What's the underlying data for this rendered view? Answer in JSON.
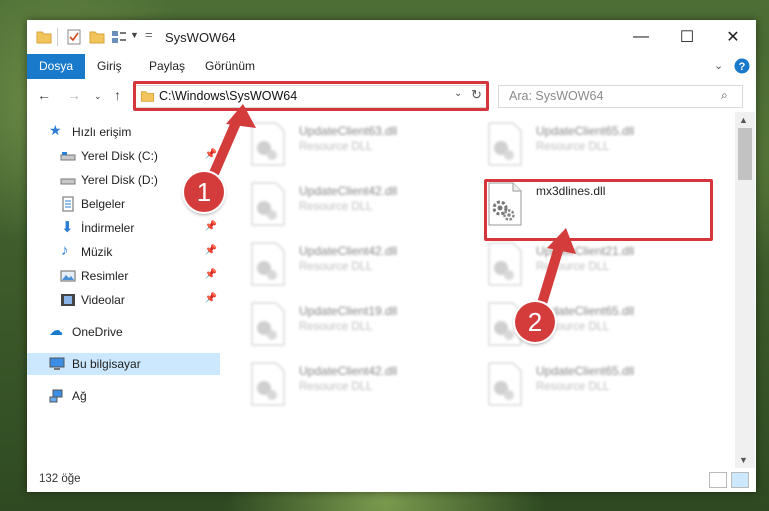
{
  "window": {
    "title": "SysWOW64",
    "quick_access_icons": [
      "folder-icon",
      "properties-icon",
      "new-folder-icon",
      "view-options-icon",
      "dropdown-arrow-icon"
    ],
    "controls": {
      "minimize": "—",
      "maximize": "☐",
      "close": "✕"
    }
  },
  "ribbon": {
    "tabs": [
      {
        "label": "Dosya"
      },
      {
        "label": "Giriş"
      },
      {
        "label": "Paylaş"
      },
      {
        "label": "Görünüm"
      }
    ],
    "expand_icon": "chevron-down-icon",
    "help_icon": "help-icon"
  },
  "address": {
    "path": "C:\\Windows\\SysWOW64",
    "search_placeholder": "Ara: SysWOW64"
  },
  "sidebar": {
    "items": [
      {
        "label": "Hızlı erişim",
        "icon": "star-icon",
        "pinned": false
      },
      {
        "label": "Yerel Disk (C:)",
        "icon": "drive-icon",
        "pinned": true
      },
      {
        "label": "Yerel Disk (D:)",
        "icon": "drive-icon",
        "pinned": true
      },
      {
        "label": "Belgeler",
        "icon": "documents-icon",
        "pinned": true
      },
      {
        "label": "İndirmeler",
        "icon": "download-icon",
        "pinned": true
      },
      {
        "label": "Müzik",
        "icon": "music-icon",
        "pinned": true
      },
      {
        "label": "Resimler",
        "icon": "pictures-icon",
        "pinned": true
      },
      {
        "label": "Videolar",
        "icon": "videos-icon",
        "pinned": true
      },
      {
        "label": "OneDrive",
        "icon": "cloud-icon",
        "pinned": false
      },
      {
        "label": "Bu bilgisayar",
        "icon": "computer-icon",
        "pinned": false,
        "selected": true
      },
      {
        "label": "Ağ",
        "icon": "network-icon",
        "pinned": false
      }
    ]
  },
  "files": [
    {
      "name": "UpdateClient63.dll",
      "type": "Resource DLL",
      "blurred": true
    },
    {
      "name": "UpdateClient65.dll",
      "type": "Resource DLL",
      "blurred": true
    },
    {
      "name": "UpdateClient42.dll",
      "type": "Resource DLL",
      "blurred": true
    },
    {
      "name": "mx3dlines.dll",
      "type": "",
      "blurred": false,
      "highlighted": true
    },
    {
      "name": "UpdateClient42.dll",
      "type": "Resource DLL",
      "blurred": true
    },
    {
      "name": "UpdateClient21.dll",
      "type": "Resource DLL",
      "blurred": true
    },
    {
      "name": "UpdateClient19.dll",
      "type": "Resource DLL",
      "blurred": true
    },
    {
      "name": "UpdateClient65.dll",
      "type": "Resource DLL",
      "blurred": true
    },
    {
      "name": "UpdateClient42.dll",
      "type": "Resource DLL",
      "blurred": true
    },
    {
      "name": "UpdateClient65.dll",
      "type": "Resource DLL",
      "blurred": true
    }
  ],
  "status": {
    "item_count": "132 öğe"
  },
  "callouts": [
    {
      "label": "1"
    },
    {
      "label": "2"
    }
  ],
  "colors": {
    "accent": "#1979ca",
    "highlight": "#d4363c",
    "selected": "#cce8ff"
  }
}
